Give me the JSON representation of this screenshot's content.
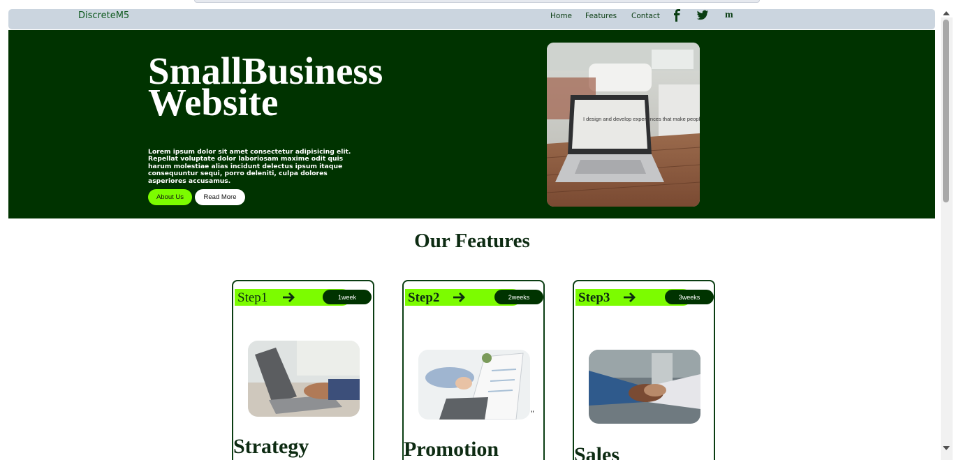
{
  "navbar": {
    "brand": "DiscreteM5",
    "links": [
      "Home",
      "Features",
      "Contact"
    ],
    "social_icons": [
      "facebook-icon",
      "twitter-icon",
      "medium-icon"
    ],
    "medium_glyph": "m"
  },
  "hero": {
    "title": "SmallBusiness Website",
    "description": "Lorem ipsum dolor sit amet consectetur adipisicing elit. Repellat voluptate dolor laboriosam maxime odit quis harum molestiae alias incidunt delectus ipsum itaque consequuntur sequi, porro deleniti, culpa dolores asperiores accusamus.",
    "buttons": [
      "About Us",
      "Read More"
    ],
    "photo_screen_text": "I design and develop experiences that make people's lives simple."
  },
  "features": {
    "title": "Our Features",
    "cards": [
      {
        "step": "Step1",
        "duration": "1week",
        "title": "Strategy"
      },
      {
        "step": "Step2",
        "duration": "2weeks",
        "title": "Promotion"
      },
      {
        "step": "Step3",
        "duration": "3weeks",
        "title": "Sales"
      }
    ],
    "stray_mark": "\""
  },
  "colors": {
    "hero_bg": "#003300",
    "accent_green": "#7cfc00",
    "navbar_bg": "#cbd5df",
    "dark_text": "#0d2b12"
  }
}
